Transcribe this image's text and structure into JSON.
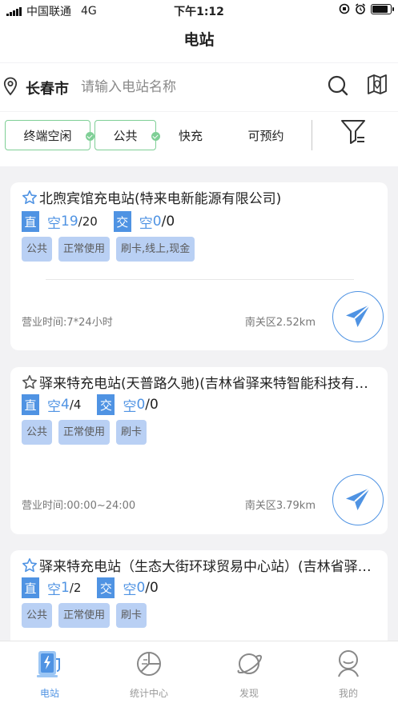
{
  "status_bar": {
    "carrier": "中国联通",
    "network": "4G",
    "time": "下午1:12"
  },
  "nav": {
    "title": "电站"
  },
  "search": {
    "city": "长春市",
    "placeholder": "请输入电站名称"
  },
  "filters": [
    {
      "label": "终端空闲",
      "active": true
    },
    {
      "label": "公共",
      "active": true
    },
    {
      "label": "快充",
      "active": false
    },
    {
      "label": "可预约",
      "active": false
    }
  ],
  "stations": [
    {
      "name": "北煦宾馆充电站(特来电新能源有限公司)",
      "dc_label": "直",
      "dc_free_label": "空",
      "dc_free": "19",
      "dc_total": "/20",
      "ac_label": "交",
      "ac_free_label": "空",
      "ac_free": "0",
      "ac_total": "/0",
      "tags": [
        "公共",
        "正常使用",
        "刷卡,线上,现金"
      ],
      "hours": "营业时间:7*24小时",
      "distance": "南关区2.52km"
    },
    {
      "name": "驿来特充电站(天普路久驰)(吉林省驿来特智能科技有限公司)",
      "dc_label": "直",
      "dc_free_label": "空",
      "dc_free": "4",
      "dc_total": "/4",
      "ac_label": "交",
      "ac_free_label": "空",
      "ac_free": "0",
      "ac_total": "/0",
      "tags": [
        "公共",
        "正常使用",
        "刷卡"
      ],
      "hours": "营业时间:00:00~24:00",
      "distance": "南关区3.79km"
    },
    {
      "name": "驿来特充电站（生态大街环球贸易中心站）(吉林省驿来特智能科技有限公司)",
      "dc_label": "直",
      "dc_free_label": "空",
      "dc_free": "1",
      "dc_total": "/2",
      "ac_label": "交",
      "ac_free_label": "空",
      "ac_free": "0",
      "ac_total": "/0",
      "tags": [
        "公共",
        "正常使用",
        "刷卡"
      ],
      "hours": "",
      "distance": ""
    }
  ],
  "tabbar": {
    "items": [
      {
        "label": "电站",
        "icon": "charging-station-icon",
        "active": true
      },
      {
        "label": "统计中心",
        "icon": "pie-chart-icon",
        "active": false
      },
      {
        "label": "发现",
        "icon": "planet-icon",
        "active": false
      },
      {
        "label": "我的",
        "icon": "user-icon",
        "active": false
      }
    ]
  },
  "colors": {
    "accent": "#4f93e3",
    "check": "#7fcf96",
    "tag_bg": "#b9d0f4",
    "page_bg": "#f2f2f4"
  }
}
